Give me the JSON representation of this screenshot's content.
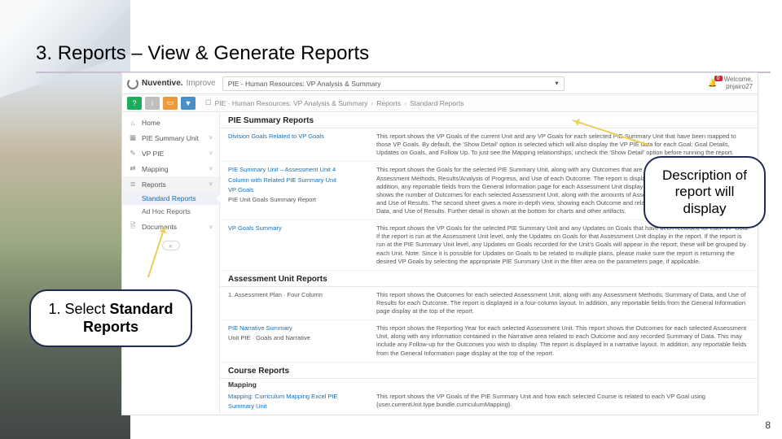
{
  "slide": {
    "title_prefix": "3. ",
    "title_main": "Reports – View & Generate Reports",
    "page_number": "8"
  },
  "callouts": {
    "c1_prefix": "1. ",
    "c1_action": "Select ",
    "c1_target": "Standard Reports",
    "c2": "Description of report will display"
  },
  "app": {
    "brand_name": "Nuventive.",
    "brand_sub": "Improve",
    "unit_label": "PIE - Human Resources: VP Analysis & Summary",
    "alert_count": "0",
    "welcome_label": "Welcome,",
    "welcome_user": "pnjairo27",
    "toolbar": {
      "help": "?",
      "info": "i"
    },
    "breadcrumbs": {
      "seg1": "PIE · Human Resources: VP Analysis & Summary",
      "seg2": "Reports",
      "seg3": "Standard Reports"
    },
    "nav": {
      "home": "Home",
      "pie_summary": "PIE Summary Unit",
      "vp_pie": "VP PIE",
      "mapping": "Mapping",
      "reports": "Reports",
      "standard_reports": "Standard Reports",
      "adhoc_reports": "Ad Hoc Reports",
      "documents": "Documents",
      "collapse": "«"
    }
  },
  "sections": {
    "s1": "PIE Summary Reports",
    "s2": "Assessment Unit Reports",
    "s3": "Course Reports"
  },
  "reports": {
    "r1": {
      "name": "Division Goals Related to VP Goals",
      "desc": "This report shows the VP Goals of the current Unit and any VP Goals for each selected PIE Summary Unit that have been mapped to those VP Goals. By default, the 'Show Detail' option is selected which will also display the VP PIE data for each Goal: Goal Details, Updates on Goals, and Follow Up. To just see the Mapping relationships, uncheck the 'Show Detail' option before running the report."
    },
    "r2": {
      "name1": "PIE Summary Unit – Assessment Unit 4",
      "name2": "Column with Related PIE Summary Unit",
      "name3": "VP Goals",
      "name4": "PIE Unit Goals Summary Report",
      "desc": "This report shows the Goals for the selected PIE Summary Unit, along with any Outcomes that are mapped to each Goal, and any Assessment Methods, Results/Analysis of Progress, and Use of each Outcome. The report is displayed in a four-column layout. In addition, any reportable fields from the General Information page for each Assessment Unit display at the top of the report. The report shows the number of Outcomes for each selected Assessment Unit, along with the amounts of Assessment Methods, Summary of Data, and Use of Results. The second sheet gives a more in-depth view, showing each Outcome and related Assessment Unit, Summary of Data, and Use of Results. Further detail is shown at the bottom for charts and other artifacts."
    },
    "r3": {
      "name": "VP Goals Summary",
      "desc": "This report shows the VP Goals for the selected PIE Summary Unit and any Updates on Goals that have been recorded for each VP Goal. If the report is run at the Assessment Unit level, only the Updates on Goals for that Assessment Unit display in the report. If the report is run at the PIE Summary Unit level, any Updates on Goals recorded for the Unit's Goals will appear in the report; these will be grouped by each Unit. Note: Since it is possible for Updates on Goals to be related to multiple plans, please make sure the report is returning the desired VP Goals by selecting the appropriate PIE Summary Unit in the filter area on the parameters page, if applicable."
    },
    "r4": {
      "name": "1. Assessment Plan · Four Column",
      "desc": "This report shows the Outcomes for each selected Assessment Unit, along with any Assessment Methods, Summary of Data, and Use of Results for each Outcome. The report is displayed in a four-column layout. In addition, any reportable fields from the General Information page display at the top of the report."
    },
    "r5": {
      "name1": "PIE Narrative Summary",
      "name2": "Unit PIE · Goals and Narrative",
      "desc": "This report shows the Reporting Year for each selected Assessment Unit. This report shows the Outcomes for each selected Assessment Unit, along with any information contained in the Narrative area related to each Outcome and any recorded Summary of Data. This may include any Follow-up for the Outcomes you wish to display. The report is displayed in a narrative layout. In addition, any reportable fields from the General Information page display at the top of the report."
    },
    "r6": {
      "name1": "Mapping: Curriculum Mapping Excel PIE",
      "name2": "Summary Unit",
      "desc": "This report shows the VP Goals of the PIE Summary Unit and how each selected Course is related to each VP Goal using {user.currentUnit.type.bundle.curriculumMapping}."
    }
  }
}
